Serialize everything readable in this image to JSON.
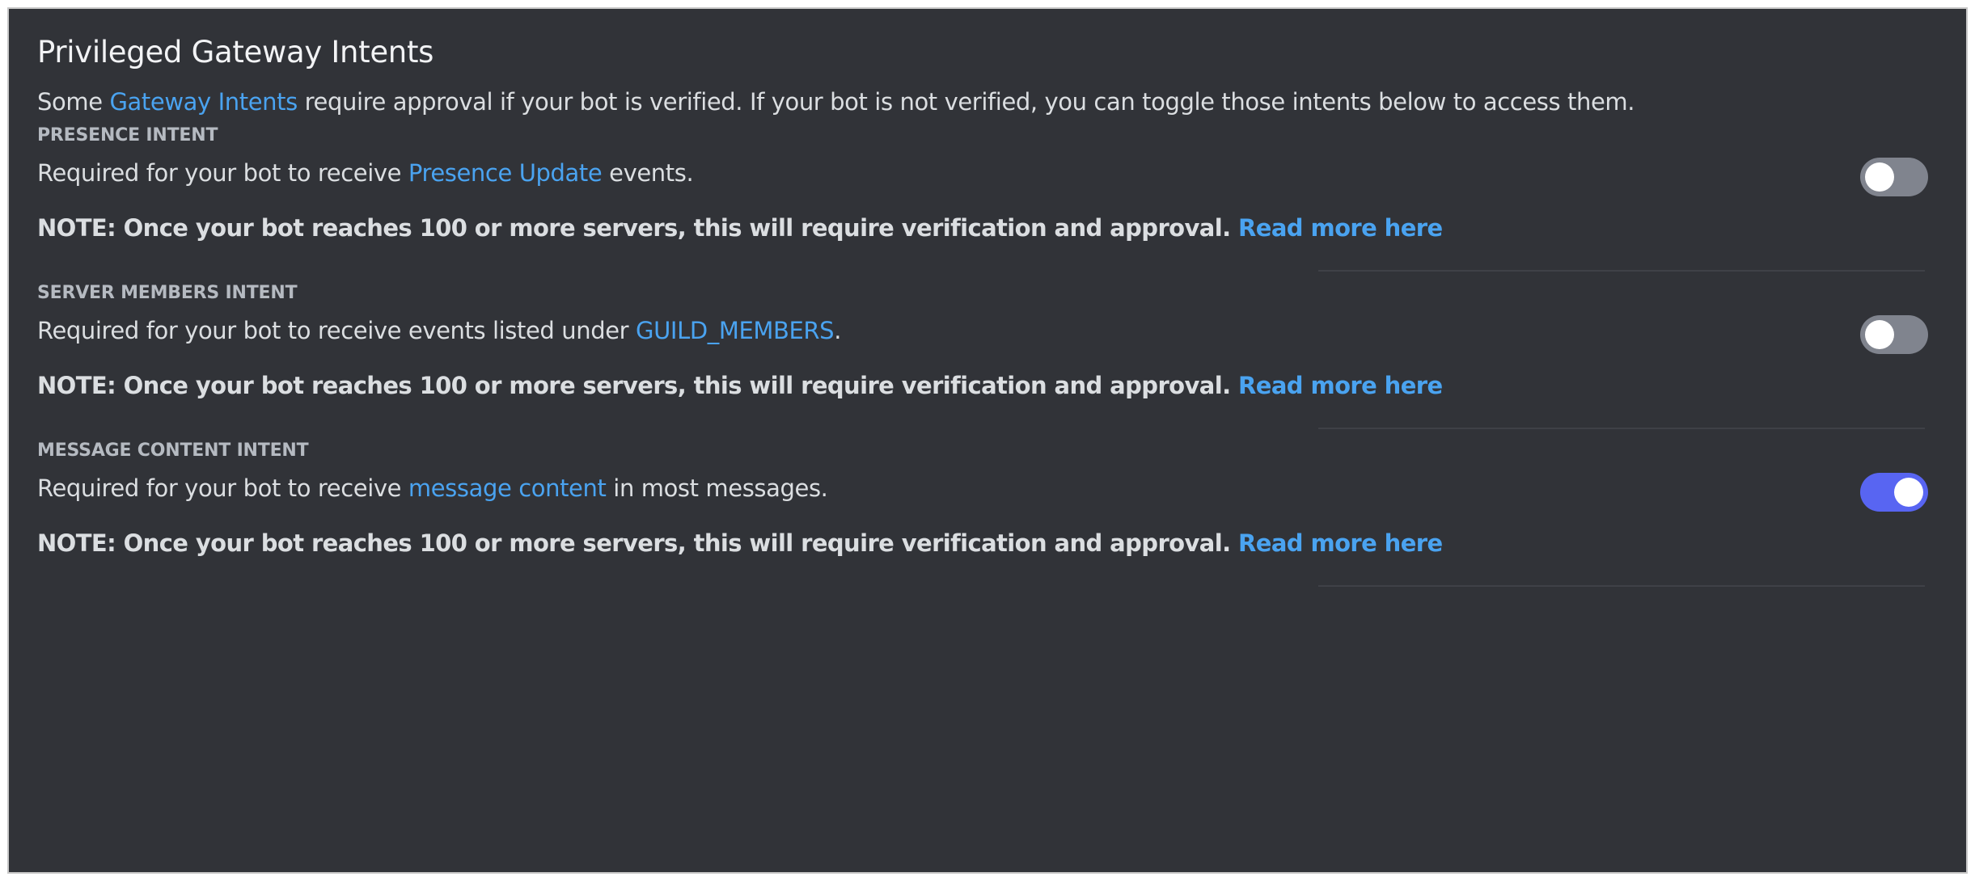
{
  "header": {
    "title": "Privileged Gateway Intents",
    "desc_before": "Some ",
    "desc_link": "Gateway Intents",
    "desc_after": " require approval if your bot is verified. If your bot is not verified, you can toggle those intents below to access them."
  },
  "colors": {
    "background": "#313338",
    "link": "#4aa3f0",
    "toggle_on": "#5865f2",
    "toggle_off": "#80848e"
  },
  "intents": [
    {
      "label": "PRESENCE INTENT",
      "text_before": "Required for your bot to receive ",
      "text_link": "Presence Update",
      "text_after": " events.",
      "note": "NOTE: Once your bot reaches 100 or more servers, this will require verification and approval. ",
      "note_link": "Read more here",
      "enabled": false
    },
    {
      "label": "SERVER MEMBERS INTENT",
      "text_before": "Required for your bot to receive events listed under ",
      "text_link": "GUILD_MEMBERS",
      "text_after": ".",
      "note": "NOTE: Once your bot reaches 100 or more servers, this will require verification and approval. ",
      "note_link": "Read more here",
      "enabled": false
    },
    {
      "label": "MESSAGE CONTENT INTENT",
      "text_before": "Required for your bot to receive ",
      "text_link": "message content",
      "text_after": " in most messages.",
      "note": "NOTE: Once your bot reaches 100 or more servers, this will require verification and approval. ",
      "note_link": "Read more here",
      "enabled": true
    }
  ]
}
